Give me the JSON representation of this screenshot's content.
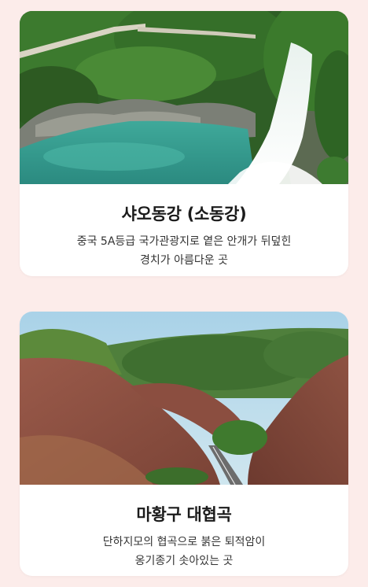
{
  "cards": [
    {
      "title": "샤오동강 (소동강)",
      "description_lines": [
        "중국 5A등급 국가관광지로 옅은 안개가 뒤덮힌",
        "경치가 아름다운 곳"
      ]
    },
    {
      "title": "마황구 대협곡",
      "description_lines": [
        "단하지모의 협곡으로 붉은 퇴적암이",
        "옹기종기 솟아있는 곳"
      ]
    }
  ],
  "colors": {
    "page_background": "#fcecea",
    "card_background": "#ffffff",
    "title_text": "#1b1b1b",
    "body_text": "#333333"
  }
}
